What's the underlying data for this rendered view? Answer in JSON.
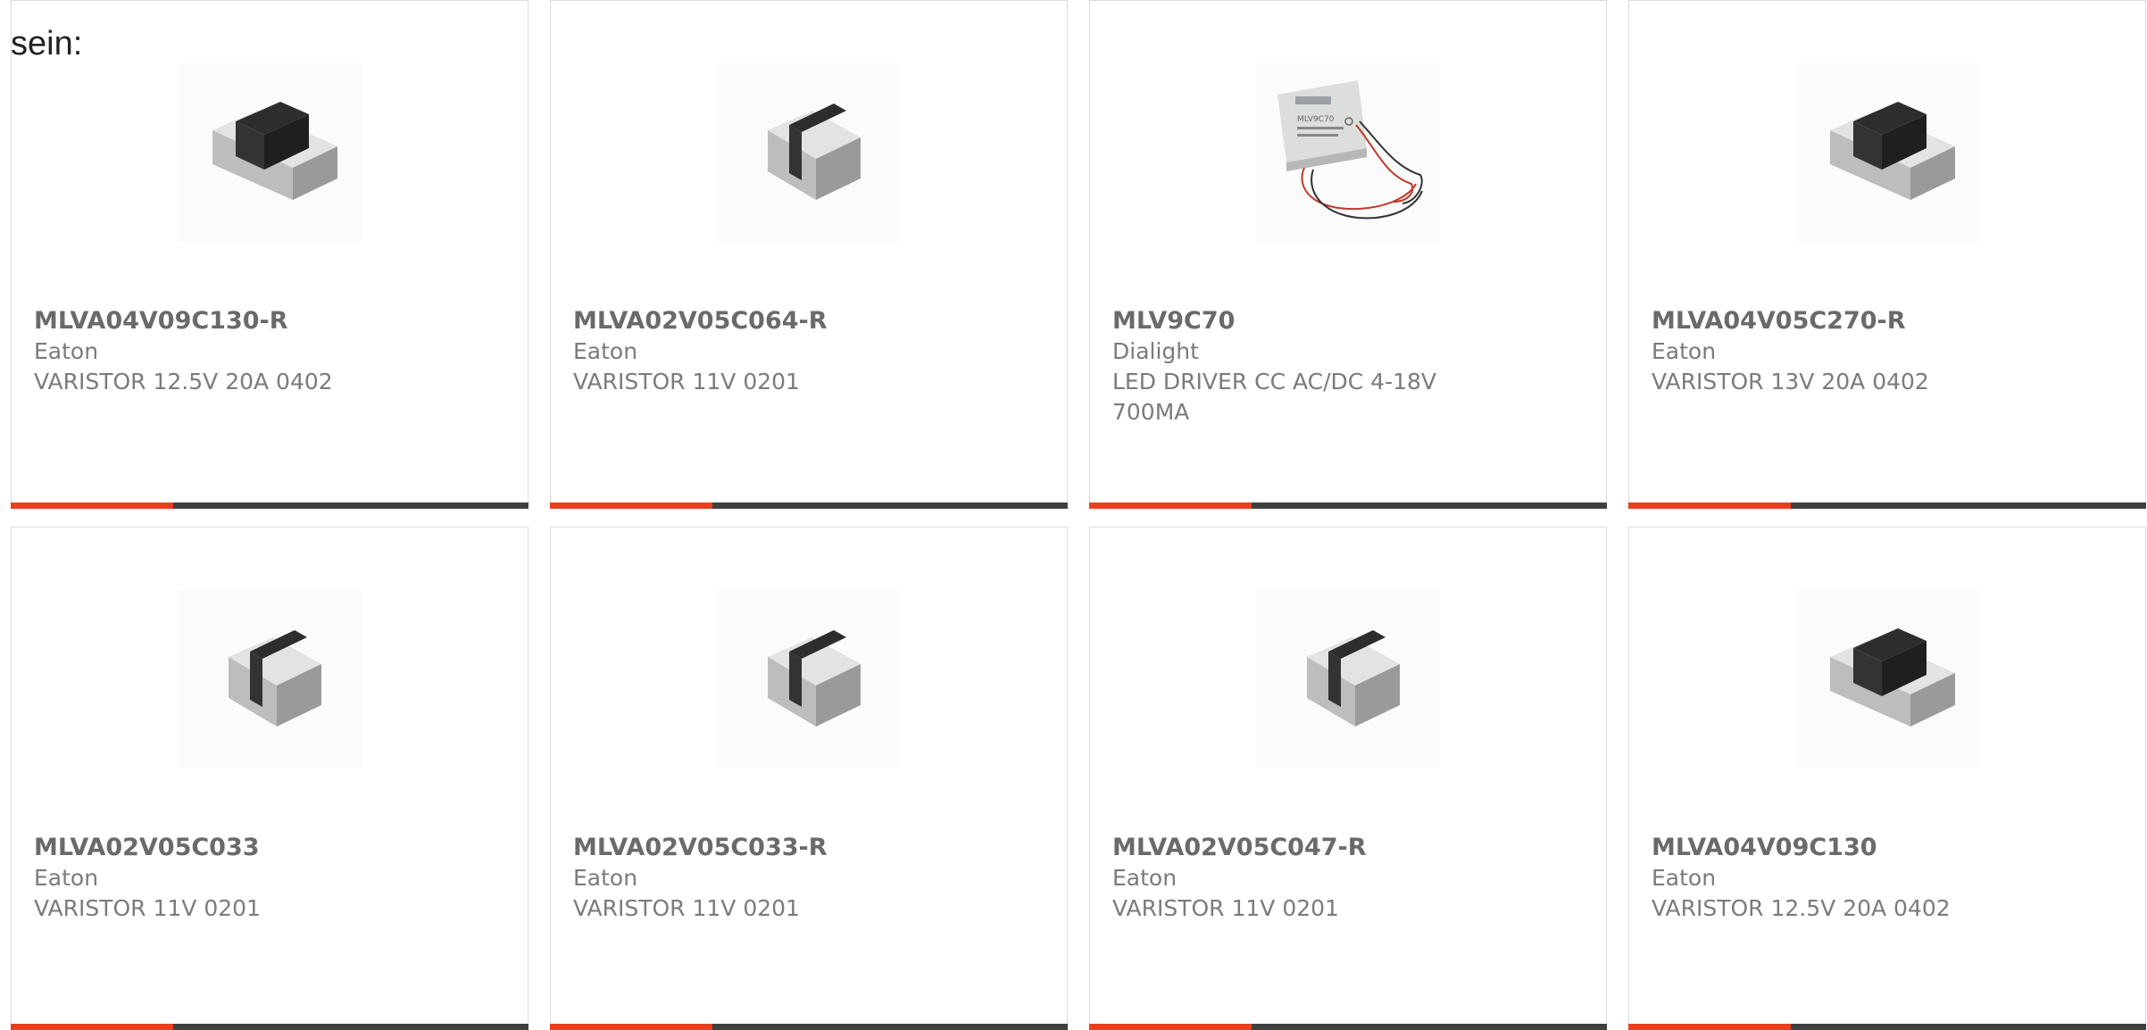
{
  "intro_text": "sein:",
  "accent_color": "#e8401c",
  "bar_color": "#3f3f3f",
  "products": [
    {
      "part_number": "MLVA04V09C130-R",
      "manufacturer": "Eaton",
      "description": "VARISTOR 12.5V 20A 0402",
      "image": "chip-varistor-icon"
    },
    {
      "part_number": "MLVA02V05C064-R",
      "manufacturer": "Eaton",
      "description": "VARISTOR 11V 0201",
      "image": "chip-varistor-icon"
    },
    {
      "part_number": "MLV9C70",
      "manufacturer": "Dialight",
      "description": "LED DRIVER CC AC/DC 4-18V 700MA",
      "image": "led-driver-icon"
    },
    {
      "part_number": "MLVA04V05C270-R",
      "manufacturer": "Eaton",
      "description": "VARISTOR 13V 20A 0402",
      "image": "chip-varistor-icon"
    },
    {
      "part_number": "MLVA02V05C033",
      "manufacturer": "Eaton",
      "description": "VARISTOR 11V 0201",
      "image": "chip-varistor-icon"
    },
    {
      "part_number": "MLVA02V05C033-R",
      "manufacturer": "Eaton",
      "description": "VARISTOR 11V 0201",
      "image": "chip-varistor-icon"
    },
    {
      "part_number": "MLVA02V05C047-R",
      "manufacturer": "Eaton",
      "description": "VARISTOR 11V 0201",
      "image": "chip-varistor-icon"
    },
    {
      "part_number": "MLVA04V09C130",
      "manufacturer": "Eaton",
      "description": "VARISTOR 12.5V 20A 0402",
      "image": "chip-varistor-icon"
    }
  ]
}
